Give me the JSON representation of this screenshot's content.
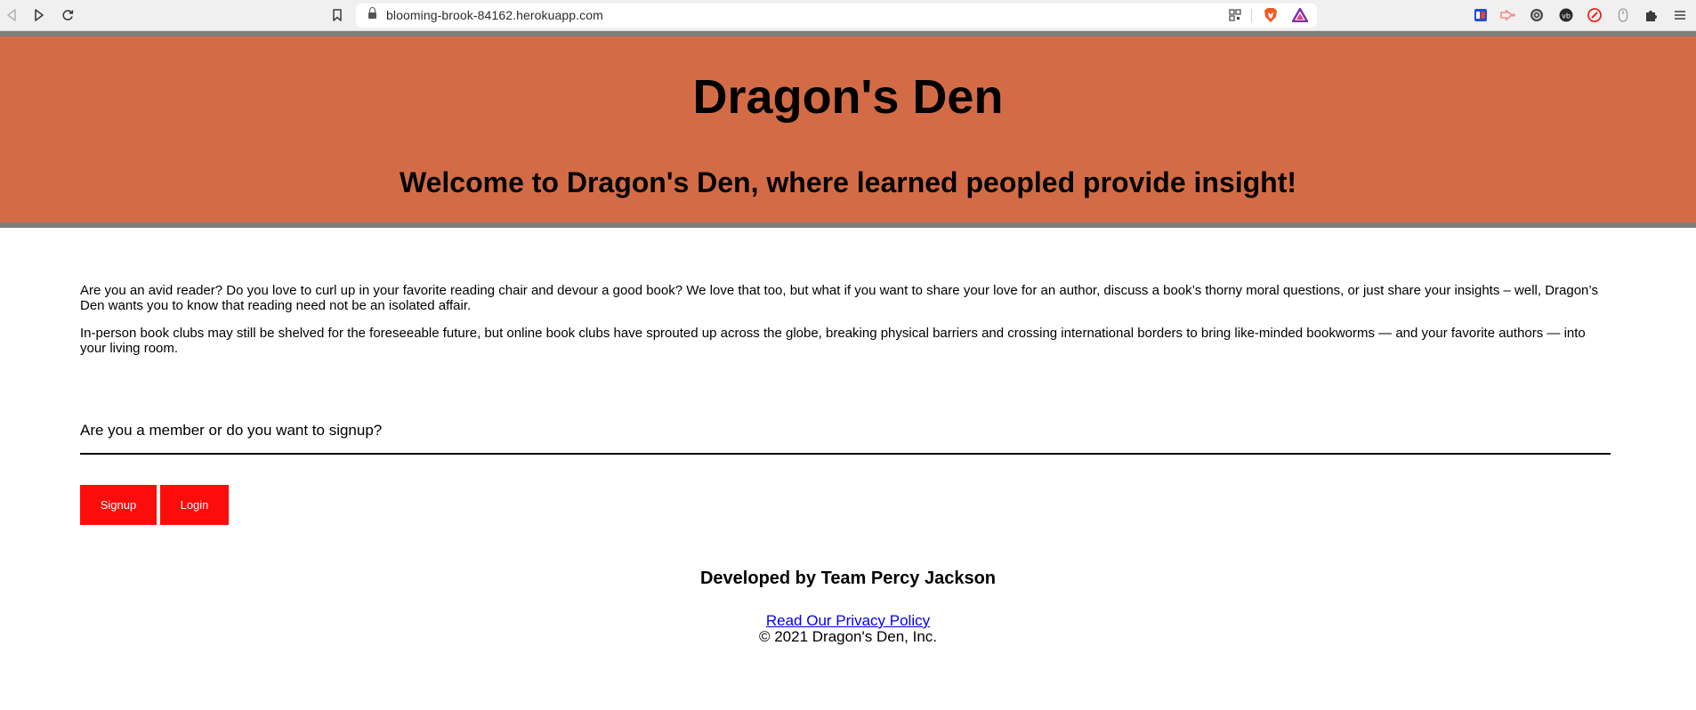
{
  "browser": {
    "url": "blooming-brook-84162.herokuapp.com",
    "icons": [
      "back-icon",
      "play-icon",
      "reload-icon",
      "bookmark-icon",
      "lock-icon",
      "qr-icon",
      "brave-shield-icon",
      "brave-rewards-icon"
    ],
    "extensions": [
      "extension-1-icon",
      "extension-2-icon",
      "extension-3-icon",
      "extension-4-icon",
      "extension-5-icon",
      "extension-6-icon",
      "puzzle-icon",
      "menu-icon"
    ]
  },
  "header": {
    "title": "Dragon's Den",
    "subtitle": "Welcome to Dragon's Den, where learned peopled provide insight!"
  },
  "intro": {
    "p1": "Are you an avid reader? Do you love to curl up in your favorite reading chair and devour a good book? We love that too, but what if you want to share your love for an author, discuss a book’s thorny moral questions, or just share your insights – well, Dragon’s Den wants you to know that reading need not be an isolated affair.",
    "p2": "In-person book clubs may still be shelved for the foreseeable future, but online book clubs have sprouted up across the globe, breaking physical barriers and crossing international borders to bring like-minded bookworms — and your favorite authors — into your living room."
  },
  "auth": {
    "question": "Are you a member or do you want to signup?",
    "signup_label": "Signup",
    "login_label": "Login"
  },
  "footer": {
    "developed_by": "Developed by Team Percy Jackson",
    "privacy_link": "Read Our Privacy Policy",
    "copyright": "© 2021 Dragon's Den, Inc."
  },
  "colors": {
    "header_bg": "#d36c46",
    "header_border": "#7d7d7d",
    "button_bg": "#fe0b0b",
    "link": "#0000ee"
  }
}
